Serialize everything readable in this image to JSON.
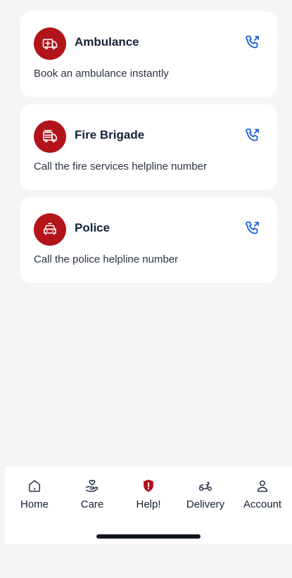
{
  "cards": [
    {
      "title": "Ambulance",
      "subtitle": "Book an ambulance instantly",
      "icon": "ambulance-icon"
    },
    {
      "title": "Fire Brigade",
      "subtitle": "Call the fire services helpline number",
      "icon": "fire-truck-icon"
    },
    {
      "title": "Police",
      "subtitle": "Call the police helpline number",
      "icon": "police-car-icon"
    }
  ],
  "tabbar": {
    "items": [
      {
        "label": "Home",
        "icon": "home-icon",
        "active": false
      },
      {
        "label": "Care",
        "icon": "care-icon",
        "active": false
      },
      {
        "label": "Help!",
        "icon": "help-shield-icon",
        "active": true
      },
      {
        "label": "Delivery",
        "icon": "scooter-icon",
        "active": false
      },
      {
        "label": "Account",
        "icon": "user-icon",
        "active": false
      }
    ]
  },
  "colors": {
    "brand_red": "#b3141a",
    "call_blue": "#1a5fd6",
    "text_dark": "#14213a",
    "background": "#f4f5f7"
  }
}
